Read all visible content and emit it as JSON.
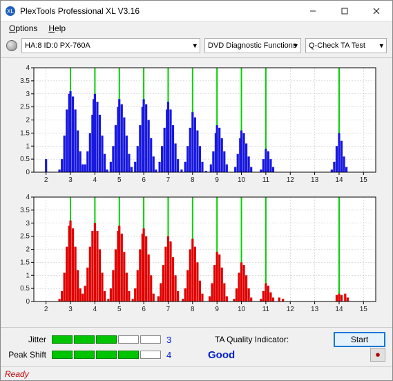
{
  "window": {
    "title": "PlexTools Professional XL V3.16"
  },
  "menu": {
    "options": "Options",
    "help": "Help"
  },
  "toolbar": {
    "device": "HA:8 ID:0   PX-760A",
    "fn": "DVD Diagnostic Functions",
    "test": "Q-Check TA Test"
  },
  "chart_data": [
    {
      "type": "bar",
      "color": "#1818e0",
      "xlim": [
        1.5,
        15.5
      ],
      "ylim": [
        0,
        4
      ],
      "yticks": [
        0,
        0.5,
        1,
        1.5,
        2,
        2.5,
        3,
        3.5,
        4
      ],
      "xticks": [
        2,
        3,
        4,
        5,
        6,
        7,
        8,
        9,
        10,
        11,
        12,
        13,
        14,
        15
      ],
      "markers": [
        3,
        4,
        5,
        6,
        7,
        8,
        9,
        10,
        11,
        14
      ],
      "series": [
        {
          "x": 2.0,
          "y": 0.5
        },
        {
          "x": 2.55,
          "y": 0.1
        },
        {
          "x": 2.65,
          "y": 0.5
        },
        {
          "x": 2.75,
          "y": 1.4
        },
        {
          "x": 2.85,
          "y": 2.4
        },
        {
          "x": 2.95,
          "y": 3.0
        },
        {
          "x": 3.0,
          "y": 3.1
        },
        {
          "x": 3.1,
          "y": 2.9
        },
        {
          "x": 3.2,
          "y": 2.4
        },
        {
          "x": 3.3,
          "y": 1.6
        },
        {
          "x": 3.4,
          "y": 0.8
        },
        {
          "x": 3.5,
          "y": 0.3
        },
        {
          "x": 3.6,
          "y": 0.3
        },
        {
          "x": 3.7,
          "y": 0.8
        },
        {
          "x": 3.8,
          "y": 1.5
        },
        {
          "x": 3.9,
          "y": 2.2
        },
        {
          "x": 3.95,
          "y": 2.8
        },
        {
          "x": 4.0,
          "y": 3.0
        },
        {
          "x": 4.1,
          "y": 2.7
        },
        {
          "x": 4.2,
          "y": 2.2
        },
        {
          "x": 4.3,
          "y": 1.4
        },
        {
          "x": 4.4,
          "y": 0.7
        },
        {
          "x": 4.5,
          "y": 0.1
        },
        {
          "x": 4.65,
          "y": 0.4
        },
        {
          "x": 4.75,
          "y": 1.0
        },
        {
          "x": 4.85,
          "y": 1.8
        },
        {
          "x": 4.95,
          "y": 2.5
        },
        {
          "x": 5.0,
          "y": 2.8
        },
        {
          "x": 5.1,
          "y": 2.6
        },
        {
          "x": 5.2,
          "y": 2.1
        },
        {
          "x": 5.3,
          "y": 1.4
        },
        {
          "x": 5.4,
          "y": 0.7
        },
        {
          "x": 5.5,
          "y": 0.2
        },
        {
          "x": 5.65,
          "y": 0.4
        },
        {
          "x": 5.75,
          "y": 1.0
        },
        {
          "x": 5.85,
          "y": 1.8
        },
        {
          "x": 5.95,
          "y": 2.5
        },
        {
          "x": 6.0,
          "y": 2.8
        },
        {
          "x": 6.1,
          "y": 2.6
        },
        {
          "x": 6.2,
          "y": 2.0
        },
        {
          "x": 6.3,
          "y": 1.3
        },
        {
          "x": 6.4,
          "y": 0.6
        },
        {
          "x": 6.5,
          "y": 0.1
        },
        {
          "x": 6.65,
          "y": 0.4
        },
        {
          "x": 6.75,
          "y": 1.0
        },
        {
          "x": 6.85,
          "y": 1.7
        },
        {
          "x": 6.95,
          "y": 2.4
        },
        {
          "x": 7.0,
          "y": 2.7
        },
        {
          "x": 7.1,
          "y": 2.4
        },
        {
          "x": 7.2,
          "y": 1.8
        },
        {
          "x": 7.3,
          "y": 1.1
        },
        {
          "x": 7.4,
          "y": 0.5
        },
        {
          "x": 7.55,
          "y": 0.1
        },
        {
          "x": 7.7,
          "y": 0.4
        },
        {
          "x": 7.8,
          "y": 1.0
        },
        {
          "x": 7.9,
          "y": 1.7
        },
        {
          "x": 8.0,
          "y": 2.3
        },
        {
          "x": 8.1,
          "y": 2.1
        },
        {
          "x": 8.2,
          "y": 1.6
        },
        {
          "x": 8.3,
          "y": 1.0
        },
        {
          "x": 8.4,
          "y": 0.4
        },
        {
          "x": 8.55,
          "y": 0.05
        },
        {
          "x": 8.75,
          "y": 0.3
        },
        {
          "x": 8.85,
          "y": 0.8
        },
        {
          "x": 8.95,
          "y": 1.5
        },
        {
          "x": 9.0,
          "y": 1.8
        },
        {
          "x": 9.1,
          "y": 1.7
        },
        {
          "x": 9.2,
          "y": 1.3
        },
        {
          "x": 9.3,
          "y": 0.8
        },
        {
          "x": 9.4,
          "y": 0.3
        },
        {
          "x": 9.75,
          "y": 0.2
        },
        {
          "x": 9.85,
          "y": 0.7
        },
        {
          "x": 9.95,
          "y": 1.3
        },
        {
          "x": 10.0,
          "y": 1.6
        },
        {
          "x": 10.1,
          "y": 1.5
        },
        {
          "x": 10.2,
          "y": 1.1
        },
        {
          "x": 10.3,
          "y": 0.6
        },
        {
          "x": 10.4,
          "y": 0.2
        },
        {
          "x": 10.8,
          "y": 0.1
        },
        {
          "x": 10.9,
          "y": 0.5
        },
        {
          "x": 11.0,
          "y": 0.9
        },
        {
          "x": 11.1,
          "y": 0.8
        },
        {
          "x": 11.2,
          "y": 0.5
        },
        {
          "x": 11.3,
          "y": 0.2
        },
        {
          "x": 13.7,
          "y": 0.1
        },
        {
          "x": 13.8,
          "y": 0.4
        },
        {
          "x": 13.9,
          "y": 1.0
        },
        {
          "x": 14.0,
          "y": 1.5
        },
        {
          "x": 14.1,
          "y": 1.2
        },
        {
          "x": 14.2,
          "y": 0.6
        },
        {
          "x": 14.3,
          "y": 0.2
        }
      ]
    },
    {
      "type": "bar",
      "color": "#e00000",
      "xlim": [
        1.5,
        15.5
      ],
      "ylim": [
        0,
        4
      ],
      "yticks": [
        0,
        0.5,
        1,
        1.5,
        2,
        2.5,
        3,
        3.5,
        4
      ],
      "xticks": [
        2,
        3,
        4,
        5,
        6,
        7,
        8,
        9,
        10,
        11,
        12,
        13,
        14,
        15
      ],
      "markers": [
        3,
        4,
        5,
        6,
        7,
        8,
        9,
        10,
        11,
        14
      ],
      "series": [
        {
          "x": 2.55,
          "y": 0.1
        },
        {
          "x": 2.65,
          "y": 0.4
        },
        {
          "x": 2.75,
          "y": 1.1
        },
        {
          "x": 2.85,
          "y": 2.1
        },
        {
          "x": 2.95,
          "y": 2.9
        },
        {
          "x": 3.0,
          "y": 3.1
        },
        {
          "x": 3.1,
          "y": 2.8
        },
        {
          "x": 3.2,
          "y": 2.1
        },
        {
          "x": 3.3,
          "y": 1.2
        },
        {
          "x": 3.4,
          "y": 0.5
        },
        {
          "x": 3.5,
          "y": 0.3
        },
        {
          "x": 3.6,
          "y": 0.6
        },
        {
          "x": 3.7,
          "y": 1.3
        },
        {
          "x": 3.8,
          "y": 2.1
        },
        {
          "x": 3.9,
          "y": 2.7
        },
        {
          "x": 4.0,
          "y": 3.0
        },
        {
          "x": 4.1,
          "y": 2.7
        },
        {
          "x": 4.2,
          "y": 2.0
        },
        {
          "x": 4.3,
          "y": 1.1
        },
        {
          "x": 4.4,
          "y": 0.4
        },
        {
          "x": 4.55,
          "y": 0.1
        },
        {
          "x": 4.65,
          "y": 0.5
        },
        {
          "x": 4.75,
          "y": 1.2
        },
        {
          "x": 4.85,
          "y": 2.0
        },
        {
          "x": 4.95,
          "y": 2.7
        },
        {
          "x": 5.0,
          "y": 2.9
        },
        {
          "x": 5.1,
          "y": 2.6
        },
        {
          "x": 5.2,
          "y": 1.9
        },
        {
          "x": 5.3,
          "y": 1.1
        },
        {
          "x": 5.4,
          "y": 0.4
        },
        {
          "x": 5.55,
          "y": 0.1
        },
        {
          "x": 5.65,
          "y": 0.5
        },
        {
          "x": 5.75,
          "y": 1.2
        },
        {
          "x": 5.85,
          "y": 2.0
        },
        {
          "x": 5.95,
          "y": 2.6
        },
        {
          "x": 6.0,
          "y": 2.8
        },
        {
          "x": 6.1,
          "y": 2.5
        },
        {
          "x": 6.2,
          "y": 1.8
        },
        {
          "x": 6.3,
          "y": 1.0
        },
        {
          "x": 6.4,
          "y": 0.3
        },
        {
          "x": 6.6,
          "y": 0.2
        },
        {
          "x": 6.7,
          "y": 0.7
        },
        {
          "x": 6.8,
          "y": 1.4
        },
        {
          "x": 6.9,
          "y": 2.1
        },
        {
          "x": 7.0,
          "y": 2.5
        },
        {
          "x": 7.1,
          "y": 2.3
        },
        {
          "x": 7.2,
          "y": 1.7
        },
        {
          "x": 7.3,
          "y": 1.0
        },
        {
          "x": 7.4,
          "y": 0.4
        },
        {
          "x": 7.6,
          "y": 0.1
        },
        {
          "x": 7.7,
          "y": 0.5
        },
        {
          "x": 7.8,
          "y": 1.2
        },
        {
          "x": 7.9,
          "y": 2.0
        },
        {
          "x": 8.0,
          "y": 2.4
        },
        {
          "x": 8.1,
          "y": 2.1
        },
        {
          "x": 8.2,
          "y": 1.5
        },
        {
          "x": 8.3,
          "y": 0.8
        },
        {
          "x": 8.4,
          "y": 0.3
        },
        {
          "x": 8.7,
          "y": 0.2
        },
        {
          "x": 8.8,
          "y": 0.7
        },
        {
          "x": 8.9,
          "y": 1.4
        },
        {
          "x": 9.0,
          "y": 1.9
        },
        {
          "x": 9.1,
          "y": 1.8
        },
        {
          "x": 9.2,
          "y": 1.3
        },
        {
          "x": 9.3,
          "y": 0.7
        },
        {
          "x": 9.4,
          "y": 0.2
        },
        {
          "x": 9.7,
          "y": 0.1
        },
        {
          "x": 9.8,
          "y": 0.5
        },
        {
          "x": 9.9,
          "y": 1.1
        },
        {
          "x": 10.0,
          "y": 1.5
        },
        {
          "x": 10.1,
          "y": 1.4
        },
        {
          "x": 10.2,
          "y": 1.0
        },
        {
          "x": 10.3,
          "y": 0.5
        },
        {
          "x": 10.4,
          "y": 0.15
        },
        {
          "x": 10.8,
          "y": 0.1
        },
        {
          "x": 10.9,
          "y": 0.4
        },
        {
          "x": 11.0,
          "y": 0.7
        },
        {
          "x": 11.1,
          "y": 0.6
        },
        {
          "x": 11.2,
          "y": 0.35
        },
        {
          "x": 11.3,
          "y": 0.15
        },
        {
          "x": 11.55,
          "y": 0.15
        },
        {
          "x": 11.7,
          "y": 0.1
        },
        {
          "x": 13.9,
          "y": 0.25
        },
        {
          "x": 14.0,
          "y": 0.3
        },
        {
          "x": 14.1,
          "y": 0.25
        },
        {
          "x": 14.25,
          "y": 0.3
        },
        {
          "x": 14.35,
          "y": 0.15
        }
      ]
    }
  ],
  "bottom": {
    "jitter_label": "Jitter",
    "jitter_value": "3",
    "jitter_segments": 5,
    "jitter_on": 3,
    "peak_label": "Peak Shift",
    "peak_value": "4",
    "peak_segments": 5,
    "peak_on": 4,
    "qual_label": "TA Quality Indicator:",
    "qual_value": "Good",
    "start": "Start",
    "record_glyph": "⏺"
  },
  "status": {
    "text": "Ready"
  }
}
